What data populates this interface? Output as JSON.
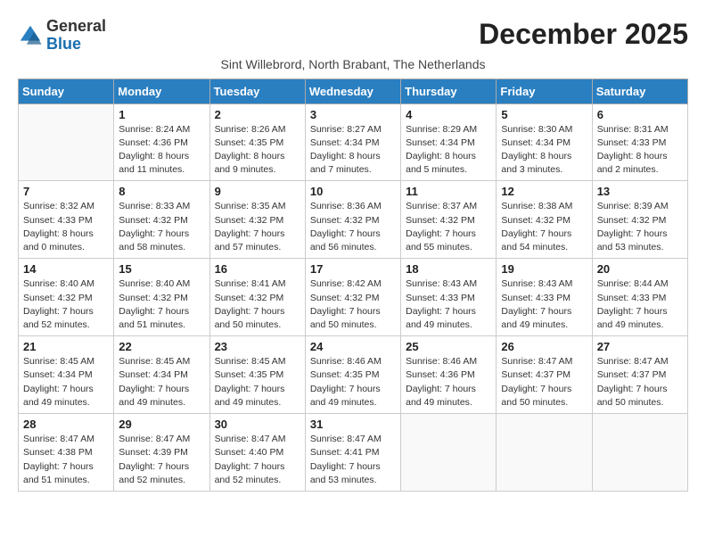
{
  "logo": {
    "line1": "General",
    "line2": "Blue"
  },
  "title": "December 2025",
  "location": "Sint Willebrord, North Brabant, The Netherlands",
  "weekdays": [
    "Sunday",
    "Monday",
    "Tuesday",
    "Wednesday",
    "Thursday",
    "Friday",
    "Saturday"
  ],
  "weeks": [
    [
      {
        "day": "",
        "info": ""
      },
      {
        "day": "1",
        "info": "Sunrise: 8:24 AM\nSunset: 4:36 PM\nDaylight: 8 hours\nand 11 minutes."
      },
      {
        "day": "2",
        "info": "Sunrise: 8:26 AM\nSunset: 4:35 PM\nDaylight: 8 hours\nand 9 minutes."
      },
      {
        "day": "3",
        "info": "Sunrise: 8:27 AM\nSunset: 4:34 PM\nDaylight: 8 hours\nand 7 minutes."
      },
      {
        "day": "4",
        "info": "Sunrise: 8:29 AM\nSunset: 4:34 PM\nDaylight: 8 hours\nand 5 minutes."
      },
      {
        "day": "5",
        "info": "Sunrise: 8:30 AM\nSunset: 4:34 PM\nDaylight: 8 hours\nand 3 minutes."
      },
      {
        "day": "6",
        "info": "Sunrise: 8:31 AM\nSunset: 4:33 PM\nDaylight: 8 hours\nand 2 minutes."
      }
    ],
    [
      {
        "day": "7",
        "info": "Sunrise: 8:32 AM\nSunset: 4:33 PM\nDaylight: 8 hours\nand 0 minutes."
      },
      {
        "day": "8",
        "info": "Sunrise: 8:33 AM\nSunset: 4:32 PM\nDaylight: 7 hours\nand 58 minutes."
      },
      {
        "day": "9",
        "info": "Sunrise: 8:35 AM\nSunset: 4:32 PM\nDaylight: 7 hours\nand 57 minutes."
      },
      {
        "day": "10",
        "info": "Sunrise: 8:36 AM\nSunset: 4:32 PM\nDaylight: 7 hours\nand 56 minutes."
      },
      {
        "day": "11",
        "info": "Sunrise: 8:37 AM\nSunset: 4:32 PM\nDaylight: 7 hours\nand 55 minutes."
      },
      {
        "day": "12",
        "info": "Sunrise: 8:38 AM\nSunset: 4:32 PM\nDaylight: 7 hours\nand 54 minutes."
      },
      {
        "day": "13",
        "info": "Sunrise: 8:39 AM\nSunset: 4:32 PM\nDaylight: 7 hours\nand 53 minutes."
      }
    ],
    [
      {
        "day": "14",
        "info": "Sunrise: 8:40 AM\nSunset: 4:32 PM\nDaylight: 7 hours\nand 52 minutes."
      },
      {
        "day": "15",
        "info": "Sunrise: 8:40 AM\nSunset: 4:32 PM\nDaylight: 7 hours\nand 51 minutes."
      },
      {
        "day": "16",
        "info": "Sunrise: 8:41 AM\nSunset: 4:32 PM\nDaylight: 7 hours\nand 50 minutes."
      },
      {
        "day": "17",
        "info": "Sunrise: 8:42 AM\nSunset: 4:32 PM\nDaylight: 7 hours\nand 50 minutes."
      },
      {
        "day": "18",
        "info": "Sunrise: 8:43 AM\nSunset: 4:33 PM\nDaylight: 7 hours\nand 49 minutes."
      },
      {
        "day": "19",
        "info": "Sunrise: 8:43 AM\nSunset: 4:33 PM\nDaylight: 7 hours\nand 49 minutes."
      },
      {
        "day": "20",
        "info": "Sunrise: 8:44 AM\nSunset: 4:33 PM\nDaylight: 7 hours\nand 49 minutes."
      }
    ],
    [
      {
        "day": "21",
        "info": "Sunrise: 8:45 AM\nSunset: 4:34 PM\nDaylight: 7 hours\nand 49 minutes."
      },
      {
        "day": "22",
        "info": "Sunrise: 8:45 AM\nSunset: 4:34 PM\nDaylight: 7 hours\nand 49 minutes."
      },
      {
        "day": "23",
        "info": "Sunrise: 8:45 AM\nSunset: 4:35 PM\nDaylight: 7 hours\nand 49 minutes."
      },
      {
        "day": "24",
        "info": "Sunrise: 8:46 AM\nSunset: 4:35 PM\nDaylight: 7 hours\nand 49 minutes."
      },
      {
        "day": "25",
        "info": "Sunrise: 8:46 AM\nSunset: 4:36 PM\nDaylight: 7 hours\nand 49 minutes."
      },
      {
        "day": "26",
        "info": "Sunrise: 8:47 AM\nSunset: 4:37 PM\nDaylight: 7 hours\nand 50 minutes."
      },
      {
        "day": "27",
        "info": "Sunrise: 8:47 AM\nSunset: 4:37 PM\nDaylight: 7 hours\nand 50 minutes."
      }
    ],
    [
      {
        "day": "28",
        "info": "Sunrise: 8:47 AM\nSunset: 4:38 PM\nDaylight: 7 hours\nand 51 minutes."
      },
      {
        "day": "29",
        "info": "Sunrise: 8:47 AM\nSunset: 4:39 PM\nDaylight: 7 hours\nand 52 minutes."
      },
      {
        "day": "30",
        "info": "Sunrise: 8:47 AM\nSunset: 4:40 PM\nDaylight: 7 hours\nand 52 minutes."
      },
      {
        "day": "31",
        "info": "Sunrise: 8:47 AM\nSunset: 4:41 PM\nDaylight: 7 hours\nand 53 minutes."
      },
      {
        "day": "",
        "info": ""
      },
      {
        "day": "",
        "info": ""
      },
      {
        "day": "",
        "info": ""
      }
    ]
  ]
}
